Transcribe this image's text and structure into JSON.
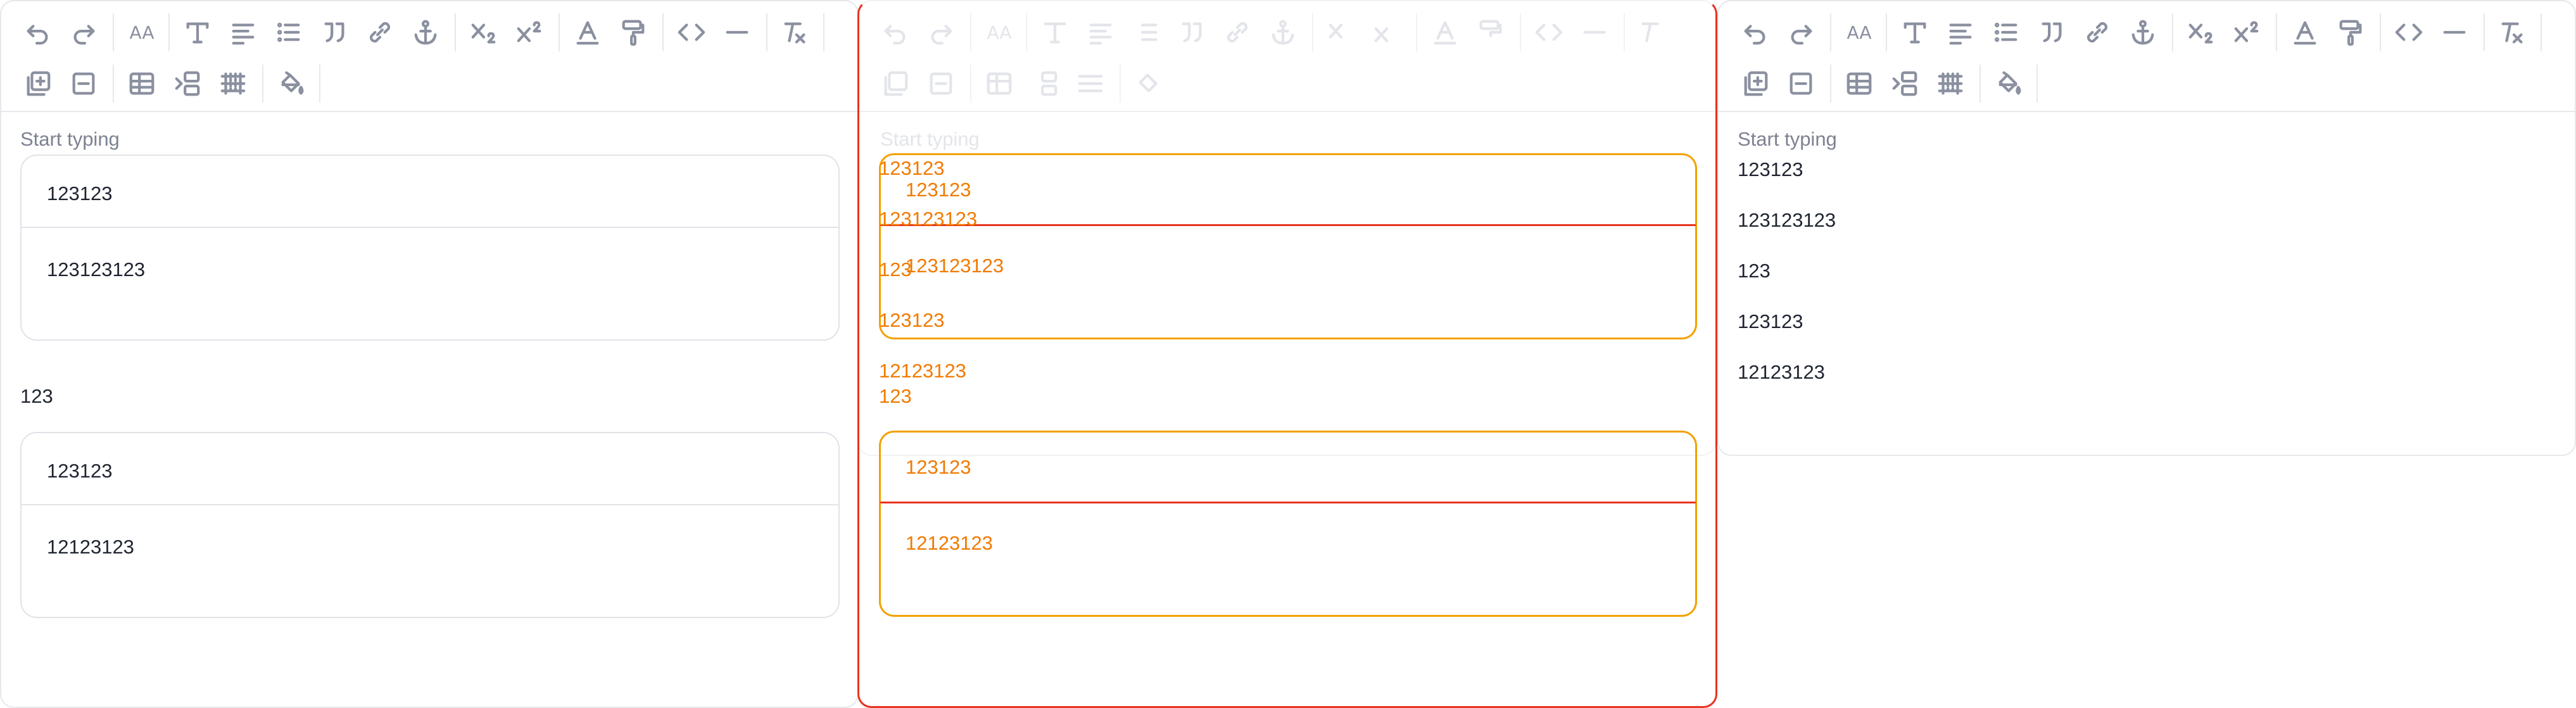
{
  "toolbar": {
    "icons": [
      "undo-icon",
      "redo-icon",
      "font-size-icon",
      "heading-icon",
      "align-icon",
      "bullet-list-icon",
      "quote-icon",
      "link-icon",
      "anchor-icon",
      "subscript-icon",
      "superscript-icon",
      "text-color-icon",
      "paint-roller-icon",
      "code-icon",
      "horizontal-rule-icon",
      "clear-format-icon",
      "add-table-icon",
      "remove-table-icon",
      "table-icon",
      "insert-row-icon",
      "table-grid-icon",
      "fill-color-icon"
    ],
    "font_size_glyph": "AA"
  },
  "editors": {
    "left": {
      "placeholder": "Start typing",
      "card1": {
        "row1": "123123",
        "row2": "123123123"
      },
      "line": "123",
      "card2": {
        "row1": "123123",
        "row2": "12123123"
      }
    },
    "middle": {
      "placeholder": "Start typing",
      "lines": [
        "123123",
        "123123123",
        "123",
        "123123",
        "12123123",
        "123"
      ],
      "card1": {
        "row1": "123123",
        "row2": "123123123"
      },
      "card2": {
        "row1": "123123",
        "row2": "12123123"
      }
    },
    "right": {
      "placeholder": "Start typing",
      "lines": [
        "123123",
        "123123123",
        "123",
        "123123",
        "12123123"
      ]
    }
  },
  "colors": {
    "overlay_text": "#f07a00",
    "overlay_box": "#e8331e",
    "overlay_card": "#f2a100",
    "icon": "#8b90a0",
    "border": "#e6e8ec"
  }
}
